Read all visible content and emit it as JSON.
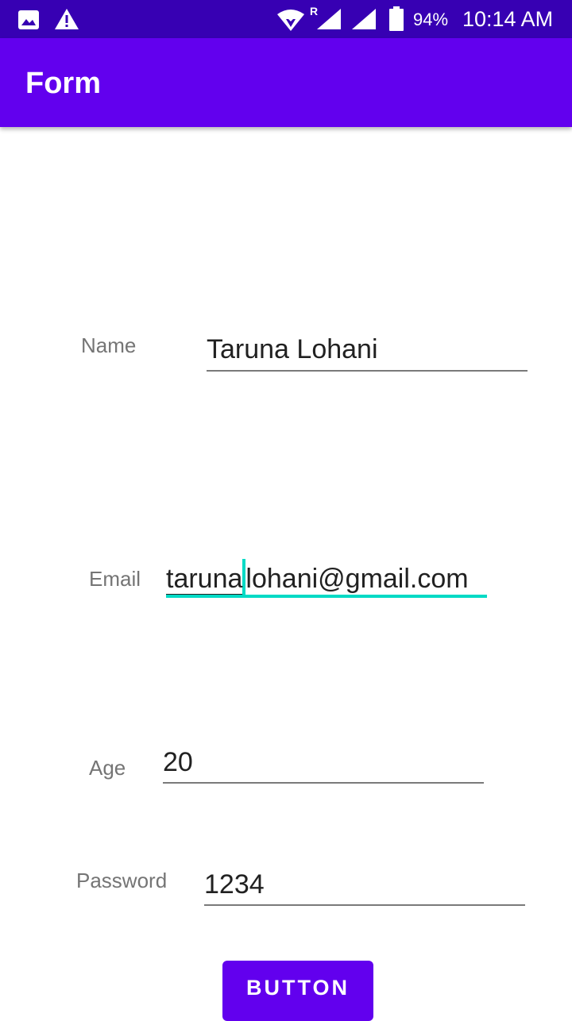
{
  "status_bar": {
    "battery_percent": "94%",
    "time": "10:14 AM",
    "roaming_indicator": "R",
    "icons": [
      "image-icon",
      "warning-icon",
      "wifi-icon",
      "signal-icon",
      "battery-icon"
    ]
  },
  "app_bar": {
    "title": "Form"
  },
  "form": {
    "name": {
      "label": "Name",
      "value": "Taruna Lohani"
    },
    "email": {
      "label": "Email",
      "value_before_cursor": "taruna",
      "value_after_cursor": "lohani@gmail.com"
    },
    "age": {
      "label": "Age",
      "value": "20"
    },
    "password": {
      "label": "Password",
      "value": "1234"
    }
  },
  "button": {
    "label": "BUTTON"
  },
  "colors": {
    "status_bar": "#3700b3",
    "primary": "#6200ee",
    "accent": "#03dac5",
    "label_text": "#757575",
    "input_text": "#212121"
  }
}
